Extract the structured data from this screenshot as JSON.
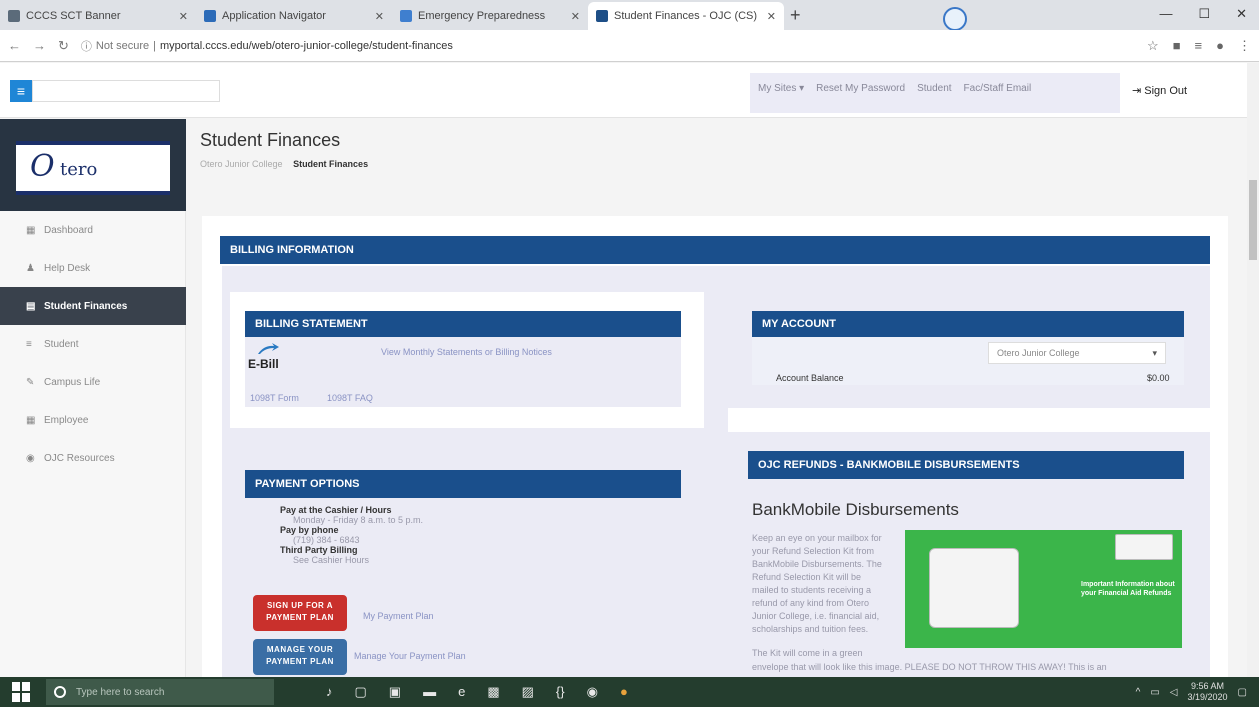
{
  "browser": {
    "tabs": [
      {
        "title": "CCCS SCT Banner"
      },
      {
        "title": "Application Navigator"
      },
      {
        "title": "Emergency Preparedness"
      },
      {
        "title": "Student Finances - OJC (CS)"
      }
    ],
    "new_tab": "+",
    "url_security": "Not secure",
    "url": "myportal.cccs.edu/web/otero-junior-college/student-finances"
  },
  "topbar": {
    "links": [
      "My Sites ▾",
      "Reset My Password",
      "Student",
      "Fac/Staff Email"
    ],
    "signout": "Sign Out"
  },
  "sidebar": {
    "logo_initial": "O",
    "logo_text": "tero",
    "items": [
      {
        "label": "Dashboard",
        "icon": "▦"
      },
      {
        "label": "Help Desk",
        "icon": "♟"
      },
      {
        "label": "Student Finances",
        "icon": "▤"
      },
      {
        "label": "Student",
        "icon": "≡"
      },
      {
        "label": "Campus Life",
        "icon": "✎"
      },
      {
        "label": "Employee",
        "icon": "▦"
      },
      {
        "label": "OJC Resources",
        "icon": "◉"
      }
    ]
  },
  "page": {
    "title": "Student Finances",
    "breadcrumb_parent": "Otero Junior College",
    "breadcrumb_current": "Student Finances"
  },
  "billing": {
    "header": "BILLING INFORMATION",
    "statement": {
      "header": "BILLING STATEMENT",
      "ebill_label": "E-Bill",
      "statements_link": "View Monthly Statements or Billing Notices",
      "form_link": "1098T Form",
      "faq_link": "1098T FAQ"
    },
    "account": {
      "header": "MY ACCOUNT",
      "select_value": "Otero Junior College",
      "balance_label": "Account Balance",
      "balance_value": "$0.00"
    },
    "payment": {
      "header": "PAYMENT OPTIONS",
      "lines": [
        {
          "text": "Pay at the Cashier / Hours",
          "bold": true
        },
        {
          "text": "Monday - Friday 8 a.m. to 5 p.m.",
          "bold": false
        },
        {
          "text": "Pay by phone",
          "bold": true
        },
        {
          "text": "(719) 384 - 6843",
          "bold": false
        },
        {
          "text": "Third Party Billing",
          "bold": true
        },
        {
          "text": "See Cashier Hours",
          "bold": false
        }
      ],
      "signup_button": "SIGN UP FOR A PAYMENT PLAN",
      "signup_link": "My Payment Plan",
      "manage_button": "MANAGE YOUR PAYMENT PLAN",
      "manage_link": "Manage Your Payment Plan"
    },
    "refunds": {
      "header": "OJC REFUNDS - BANKMOBILE DISBURSEMENTS",
      "title": "BankMobile Disbursements",
      "body_lines": [
        "Keep an eye on your mailbox for",
        "your Refund Selection Kit from",
        "BankMobile Disbursements. The",
        "Refund Selection Kit will be",
        "mailed to students receiving a",
        "refund of any kind from Otero",
        "Junior College, i.e. financial aid,",
        "scholarships and tuition fees.",
        "The Kit will come in a green",
        "envelope that will look like this image. PLEASE DO NOT THROW THIS AWAY! This is an"
      ],
      "graphic_caption": "Important Information about your Financial Aid Refunds"
    }
  },
  "taskbar": {
    "search_placeholder": "Type here to search",
    "time": "9:56 AM",
    "date": "3/19/2020"
  }
}
